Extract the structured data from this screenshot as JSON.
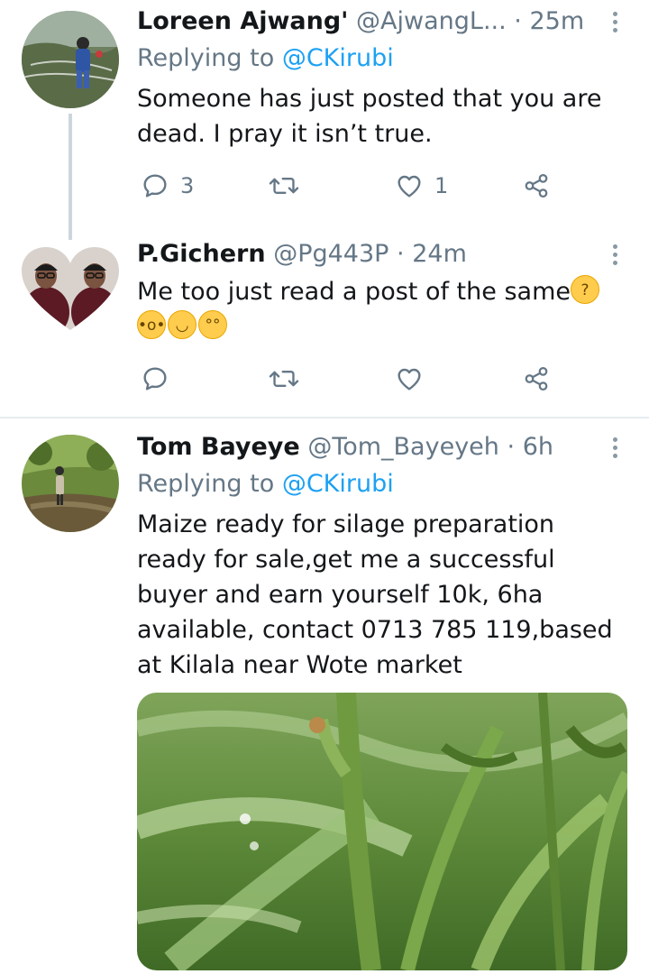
{
  "tweets": [
    {
      "name": "Loreen Ajwang'",
      "handle": "@AjwangL...",
      "separator": "·",
      "time": "25m",
      "replying_prefix": "Replying to",
      "replying_to": "@CKirubi",
      "text": "Someone has just posted that you are dead. I pray it isn’t true.",
      "reply_count": "3",
      "retweet_count": "",
      "like_count": "1",
      "avatar_icon": "profile-photo"
    },
    {
      "name": "P.Gichern",
      "handle": "@Pg443P",
      "separator": "·",
      "time": "24m",
      "text": "Me too just read a post of the same",
      "emojis": [
        "thinking-face",
        "hushed-face",
        "smirking-face",
        "eye-roll-face"
      ],
      "reply_count": "",
      "retweet_count": "",
      "like_count": "",
      "avatar_icon": "heart-shaped-profile-photo"
    },
    {
      "name": "Tom Bayeye",
      "handle": "@Tom_Bayeyeh",
      "separator": "·",
      "time": "6h",
      "replying_prefix": "Replying to",
      "replying_to": "@CKirubi",
      "text": "Maize ready for silage preparation ready for sale,get me a successful buyer and earn yourself 10k, 6ha available, contact 0713 785 119,based at Kilala near Wote market",
      "avatar_icon": "profile-photo",
      "media_icon": "maize-field-photo"
    }
  ],
  "icons": {
    "reply": "reply-icon",
    "retweet": "retweet-icon",
    "like": "heart-icon",
    "share": "share-icon",
    "more": "more-vertical-icon"
  },
  "colors": {
    "text": "#14171a",
    "secondary": "#657786",
    "link": "#1da1f2",
    "icon": "#657786",
    "thread_line": "#ccd6dd",
    "divider": "#e6ecf0"
  }
}
